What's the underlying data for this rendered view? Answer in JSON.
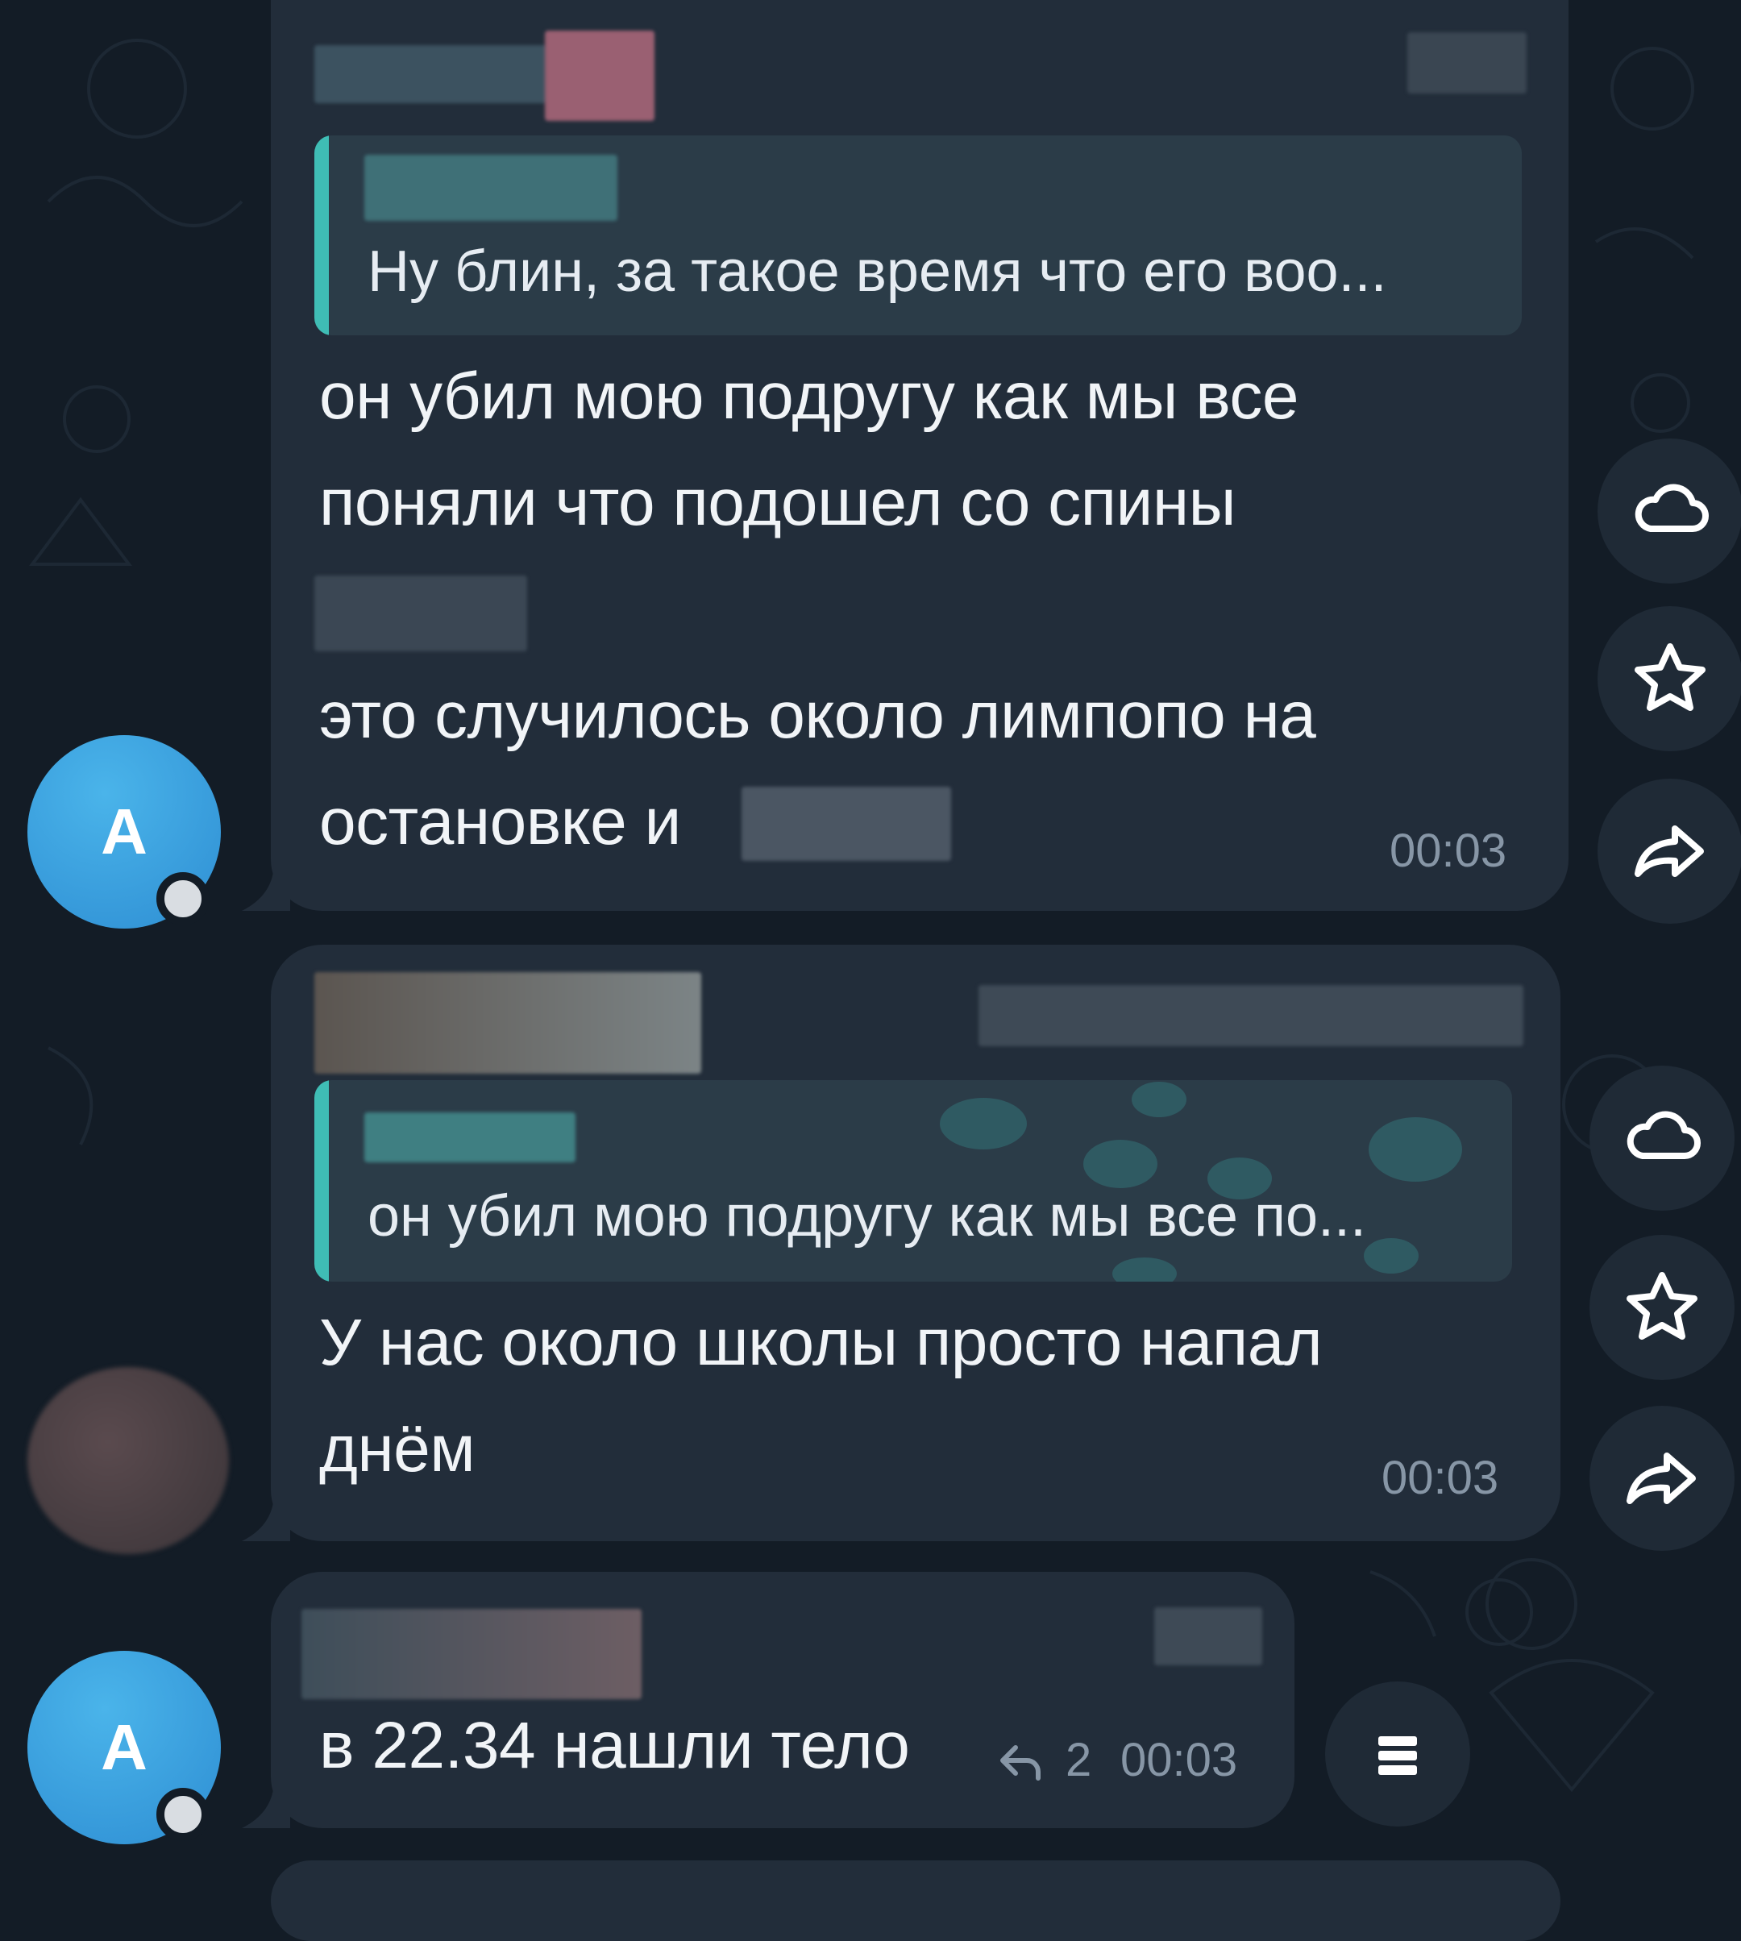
{
  "messages": [
    {
      "reply_preview": "Ну блин, за такое время что его воо...",
      "lines": [
        "он убил мою подругу как мы все",
        "поняли что подошел со спины"
      ],
      "lines2": [
        "это случилось около лимпопо на",
        "остановке и"
      ],
      "time": "00:03",
      "avatar_letter": "A"
    },
    {
      "reply_preview": "он убил мою подругу как мы все по...",
      "lines": [
        "У нас около школы просто напал",
        "днём"
      ],
      "time": "00:03"
    },
    {
      "text": "в 22.34 нашли тело",
      "replies_count": "2",
      "time": "00:03",
      "avatar_letter": "A"
    }
  ],
  "actions": [
    "cloud-icon",
    "star-icon",
    "forward-icon",
    "menu-icon"
  ],
  "colors": {
    "background": "#131c26",
    "bubble": "#222d3a",
    "accent": "#3fbdb5",
    "avatar": "#3aa3e0"
  }
}
